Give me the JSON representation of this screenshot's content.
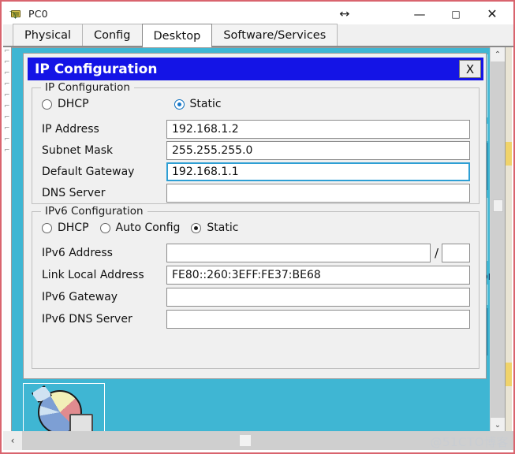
{
  "window": {
    "title": "PC0",
    "icon": "pc-device-icon",
    "resize_hint_icon": "horizontal-resize-icon",
    "minimize_label": "—",
    "maximize_label": "□",
    "close_label": "✕"
  },
  "tabs": [
    {
      "label": "Physical",
      "active": false
    },
    {
      "label": "Config",
      "active": false
    },
    {
      "label": "Desktop",
      "active": true
    },
    {
      "label": "Software/Services",
      "active": false
    }
  ],
  "dialog": {
    "title": "IP Configuration",
    "close_label": "X",
    "ipv4": {
      "legend": "IP Configuration",
      "dhcp_label": "DHCP",
      "static_label": "Static",
      "selected": "Static",
      "fields": [
        {
          "label": "IP Address",
          "value": "192.168.1.2",
          "focused": false
        },
        {
          "label": "Subnet Mask",
          "value": "255.255.255.0",
          "focused": false
        },
        {
          "label": "Default Gateway",
          "value": "192.168.1.1",
          "focused": true
        },
        {
          "label": "DNS Server",
          "value": "",
          "focused": false
        }
      ]
    },
    "ipv6": {
      "legend": "IPv6 Configuration",
      "dhcp_label": "DHCP",
      "auto_config_label": "Auto Config",
      "static_label": "Static",
      "selected": "Static",
      "address_label": "IPv6 Address",
      "address_value": "",
      "prefix_separator": "/",
      "prefix_value": "",
      "fields": [
        {
          "label": "Link Local Address",
          "value": "FE80::260:3EFF:FE37:BE68"
        },
        {
          "label": "IPv6 Gateway",
          "value": ""
        },
        {
          "label": "IPv6 DNS Server",
          "value": ""
        }
      ]
    }
  },
  "desktop": {
    "icon_name": "pie-chart-icon",
    "ghost_text_right": "or"
  },
  "scrollbars": {
    "vertical_up": "⌃",
    "vertical_down": "⌄",
    "horizontal_left": "‹"
  },
  "watermark": "@51CTO博客",
  "colors": {
    "dialog_titlebar": "#1414e6",
    "desktop_canvas": "#3fb6d3",
    "frame_border": "#d9646e",
    "focus_border": "#2e9fd4",
    "radio_selected_blue": "#1577c9"
  }
}
